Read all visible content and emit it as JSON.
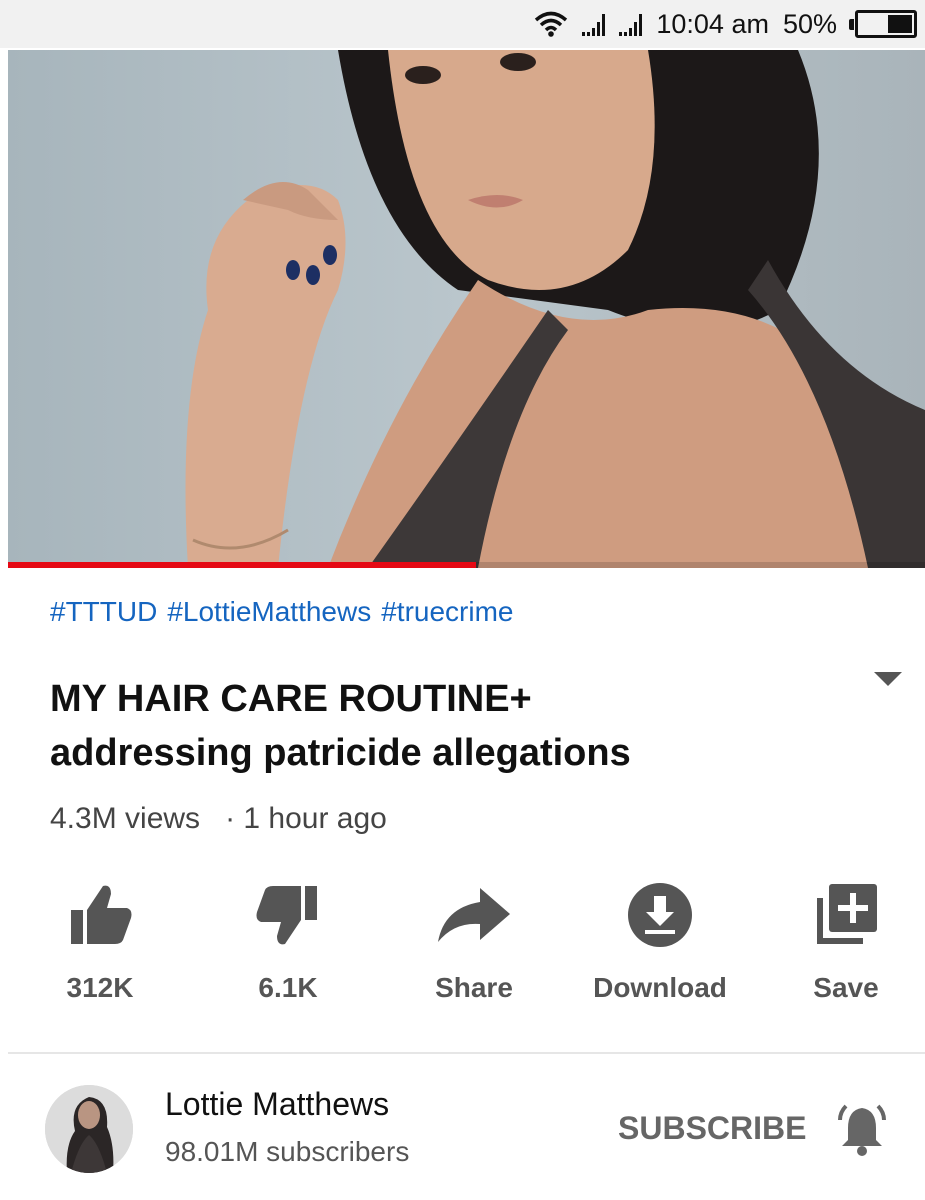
{
  "status_bar": {
    "time": "10:04 am",
    "battery": "50%",
    "battery_level": 0.5,
    "icons": [
      "wifi-icon",
      "signal-icon",
      "signal-icon",
      "battery-icon"
    ]
  },
  "video": {
    "progress": 0.51,
    "progress_color": "#e50914",
    "hashtags": [
      "#TTTUD",
      "#LottieMatthews",
      "#truecrime"
    ],
    "title_line1": "MY HAIR CARE ROUTINE+",
    "title_line2": "addressing patricide allegations",
    "views": "4.3M views",
    "age": "· 1 hour ago"
  },
  "actions": {
    "like": {
      "label": "312K",
      "icon": "thumbs-up-icon"
    },
    "dislike": {
      "label": "6.1K",
      "icon": "thumbs-down-icon"
    },
    "share": {
      "label": "Share",
      "icon": "share-arrow-icon"
    },
    "download": {
      "label": "Download",
      "icon": "download-icon"
    },
    "save": {
      "label": "Save",
      "icon": "add-to-playlist-icon"
    }
  },
  "channel": {
    "name": "Lottie Matthews",
    "subscribers": "98.01M subscribers",
    "subscribe_label": "SUBSCRIBE",
    "bell_icon": "notification-bell-icon"
  },
  "colors": {
    "hashtag": "#1565c0",
    "action_gray": "#555555"
  }
}
